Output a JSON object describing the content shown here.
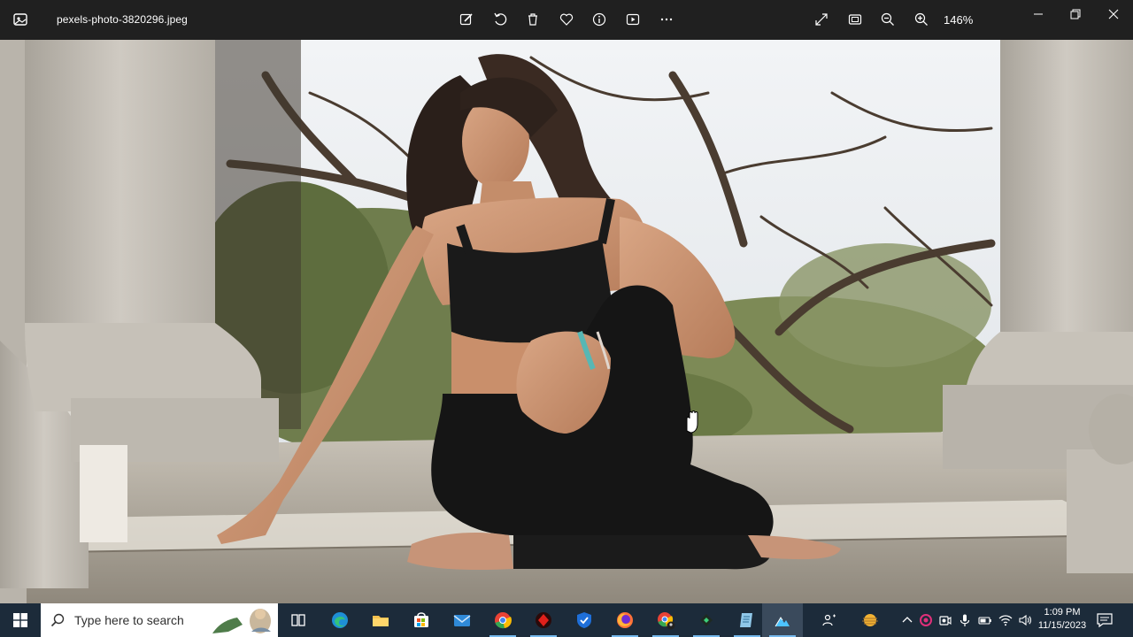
{
  "window": {
    "filename": "pexels-photo-3820296.jpeg",
    "zoom": "146%"
  },
  "toolbar": {
    "tools": [
      {
        "name": "edit-image-icon"
      },
      {
        "name": "rotate-icon"
      },
      {
        "name": "delete-icon"
      },
      {
        "name": "favorite-heart-icon"
      },
      {
        "name": "info-icon"
      },
      {
        "name": "slideshow-icon"
      },
      {
        "name": "more-icon"
      }
    ],
    "view_tools": [
      {
        "name": "fullscreen-expand-icon"
      },
      {
        "name": "fit-to-window-icon"
      },
      {
        "name": "zoom-out-icon"
      },
      {
        "name": "zoom-in-icon"
      }
    ]
  },
  "taskbar": {
    "search_placeholder": "Type here to search",
    "apps": [
      {
        "name": "task-view-icon"
      },
      {
        "name": "edge-icon"
      },
      {
        "name": "file-explorer-icon"
      },
      {
        "name": "microsoft-store-icon"
      },
      {
        "name": "mail-icon"
      },
      {
        "name": "chrome-icon"
      },
      {
        "name": "red-app-icon"
      },
      {
        "name": "shield-app-icon"
      },
      {
        "name": "firefox-icon"
      },
      {
        "name": "chrome-profile-icon"
      },
      {
        "name": "green-app-icon"
      },
      {
        "name": "notes-app-icon"
      },
      {
        "name": "photos-app-icon"
      }
    ],
    "tray": {
      "time": "1:09 PM",
      "date": "11/15/2023"
    }
  },
  "colors": {
    "titlebar": "#202020",
    "taskbar": "#1c2b3a",
    "taskbar_indicator": "#76b9ed"
  }
}
